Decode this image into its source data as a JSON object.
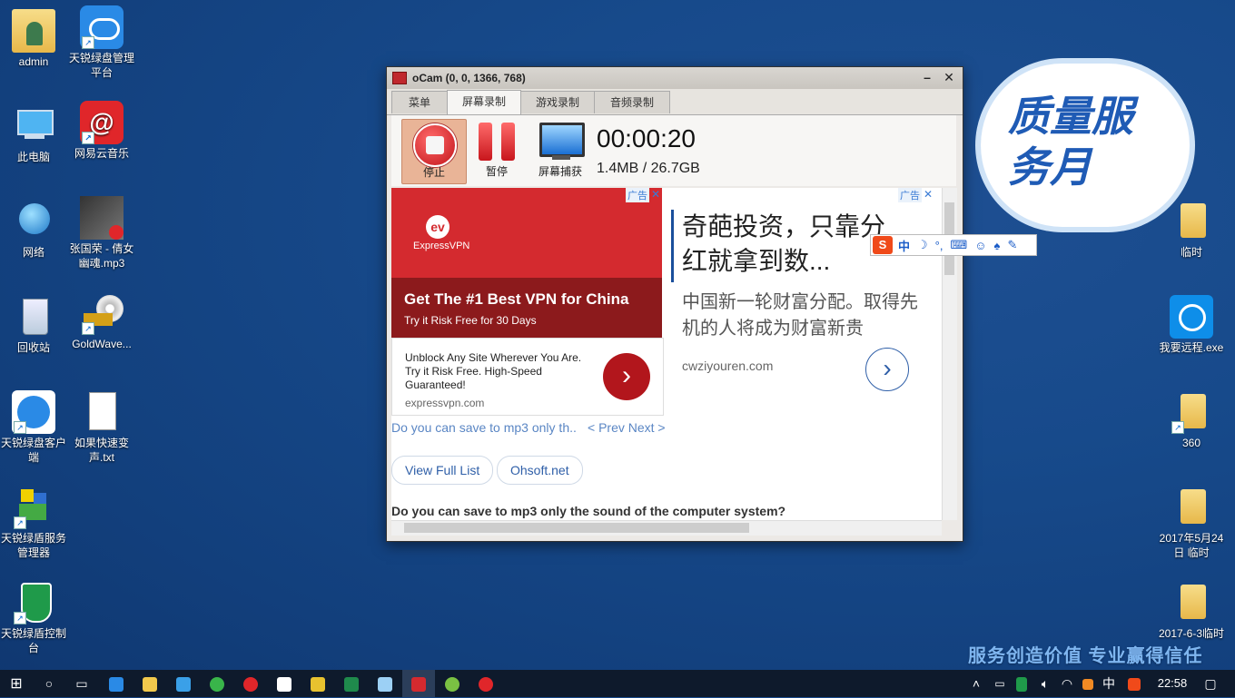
{
  "desktop": {
    "icons_left": [
      {
        "label": "admin",
        "icon": "user-folder-icon"
      },
      {
        "label": "天锐绿盘管理平台",
        "icon": "cloud-app-icon"
      },
      {
        "label": "此电脑",
        "icon": "computer-icon"
      },
      {
        "label": "网易云音乐",
        "icon": "netease-music-icon"
      },
      {
        "label": "网络",
        "icon": "network-icon"
      },
      {
        "label": "张国荣 - 倩女幽魂.mp3",
        "icon": "mp3-file-icon"
      },
      {
        "label": "回收站",
        "icon": "recycle-bin-icon"
      },
      {
        "label": "GoldWave...",
        "icon": "goldwave-icon"
      },
      {
        "label": "天锐绿盘客户端",
        "icon": "cloud-client-icon"
      },
      {
        "label": "如果快速变声.txt",
        "icon": "text-file-icon"
      },
      {
        "label": "天锐绿盾服务管理器",
        "icon": "shield-manager-icon"
      },
      {
        "label": "天锐绿盾控制台",
        "icon": "shield-console-icon"
      }
    ],
    "icons_right": [
      {
        "label": "临时",
        "icon": "folder-icon"
      },
      {
        "label": "我要远程.exe",
        "icon": "teamviewer-icon"
      },
      {
        "label": "360",
        "icon": "folder-icon"
      },
      {
        "label": "2017年5月24日 临时",
        "icon": "folder-icon"
      },
      {
        "label": "2017-6-3临时",
        "icon": "folder-icon"
      }
    ],
    "banner_text": "质量服务月",
    "slogan": "服务创造价值  专业赢得信任"
  },
  "window": {
    "title": "oCam (0, 0, 1366, 768)",
    "tabs": [
      "菜单",
      "屏幕录制",
      "游戏录制",
      "音频录制"
    ],
    "active_tab": 1,
    "toolbar": {
      "stop_label": "停止",
      "pause_label": "暂停",
      "capture_label": "屏幕捕获",
      "timer": "00:00:20",
      "size": "1.4MB / 26.7GB"
    },
    "ad_left": {
      "tag": "广告",
      "brand": "ExpressVPN",
      "headline": "Get The #1 Best VPN for China",
      "subline": "Try it Risk Free for 30 Days",
      "body": "Unblock Any Site Wherever You Are. Try it Risk Free. High-Speed Guaranteed!",
      "url": "expressvpn.com"
    },
    "ad_right": {
      "tag": "广告",
      "headline": "奇葩投资，只靠分红就拿到数...",
      "body": "中国新一轮财富分配。取得先机的人将成为财富新贵",
      "url": "cwziyouren.com"
    },
    "question_link": "Do you can save to mp3 only th..",
    "prev_next": "< Prev Next >",
    "view_full_list": "View Full List",
    "site_button": "Ohsoft.net",
    "question_title": "Do you can save to mp3 only the sound of the computer system?"
  },
  "ime": {
    "mode": "中",
    "punct": "°,"
  },
  "taskbar": {
    "clock": "22:58",
    "ime_indicator": "中"
  }
}
